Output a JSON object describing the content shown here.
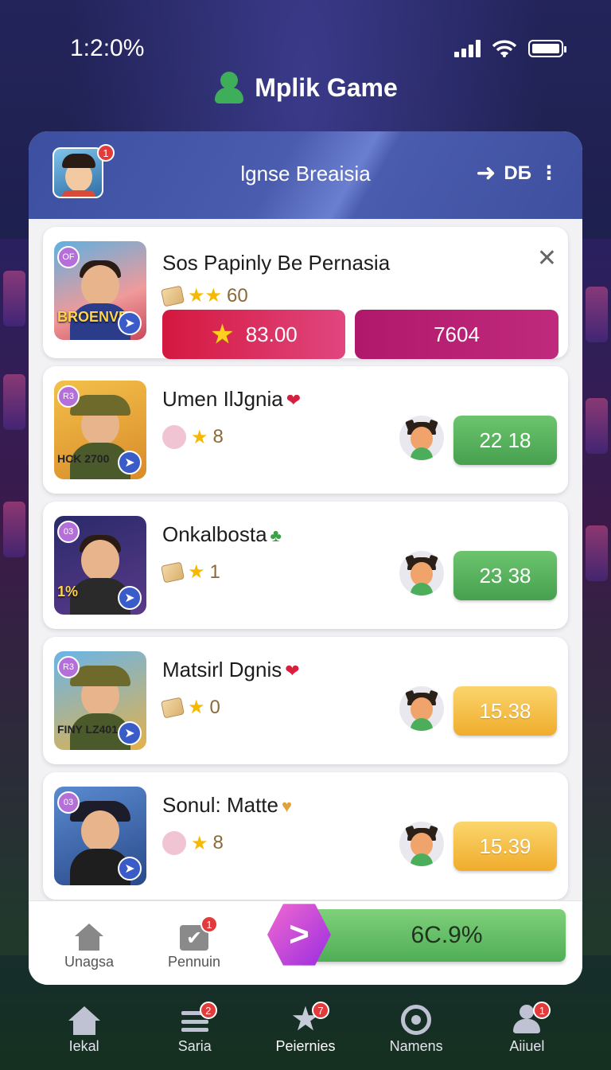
{
  "status": {
    "time": "1:2:0%"
  },
  "app": {
    "name": "Mplik Game"
  },
  "header": {
    "title": "lgnse Breaisia",
    "right_label": "DБ",
    "avatar_badge": "1"
  },
  "featured": {
    "title": "Sos Papinly Be Pernasia",
    "thumb_tag": "OF",
    "thumb_caption": "BROENVE",
    "rating": "60",
    "primary_value": "83.00",
    "secondary_value": "7604"
  },
  "matches": [
    {
      "title": "Umen IlJgnia",
      "thumb_tag": "R3",
      "thumb_caption": "HCK 2700",
      "rating": "8",
      "score": "22 18",
      "score_color": "#52a85a",
      "gem": "❤"
    },
    {
      "title": "Onkalbosta",
      "thumb_tag": "03",
      "thumb_caption": "1%",
      "rating": "1",
      "score": "23 38",
      "score_color": "#52a85a",
      "gem": "♣"
    },
    {
      "title": "Matsirl Dgnis",
      "thumb_tag": "R3",
      "thumb_caption": "FINY LZ401",
      "rating": "0",
      "score": "15.38",
      "score_color": "#f2b236",
      "gem": "❤"
    },
    {
      "title": "Sonul: Matte",
      "thumb_tag": "03",
      "thumb_caption": "",
      "rating": "8",
      "score": "15.39",
      "score_color": "#f2b236",
      "gem": "♥"
    }
  ],
  "actions": {
    "home_label": "Unagsa",
    "pending_label": "Pennuin",
    "pending_badge": "1",
    "progress_label": "6C.9%"
  },
  "nav": [
    {
      "label": "Iekal",
      "icon": "home-icon",
      "badge": ""
    },
    {
      "label": "Saria",
      "icon": "list-icon",
      "badge": "2"
    },
    {
      "label": "Peiernies",
      "icon": "star-icon",
      "badge": "7"
    },
    {
      "label": "Namens",
      "icon": "target-icon",
      "badge": ""
    },
    {
      "label": "Aiiuel",
      "icon": "user-icon",
      "badge": "1"
    }
  ],
  "colors": {
    "accent_green": "#4fae57",
    "accent_pink": "#d4183f",
    "header_blue": "#4a5cae"
  }
}
